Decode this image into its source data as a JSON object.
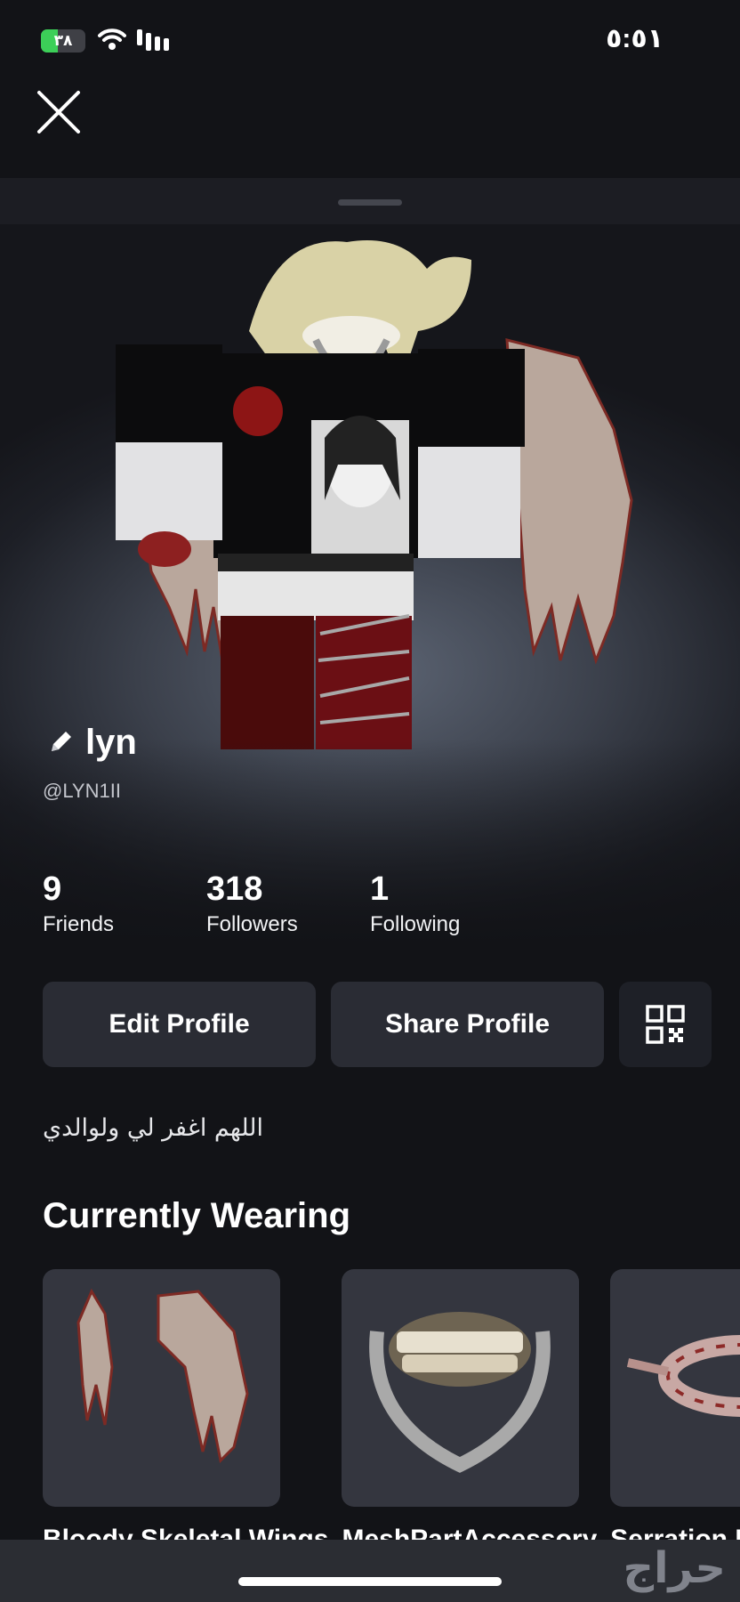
{
  "status_bar": {
    "battery_text": "٣٨",
    "battery_level": 0.38,
    "time": "٥:٥١"
  },
  "profile": {
    "display_name": "lyn",
    "username": "@LYN1II",
    "stats": [
      {
        "value": "9",
        "label": "Friends"
      },
      {
        "value": "318",
        "label": "Followers"
      },
      {
        "value": "1",
        "label": "Following"
      }
    ],
    "edit_label": "Edit Profile",
    "share_label": "Share Profile",
    "bio": "اللهم اغفر لي ولوالدي"
  },
  "wearing": {
    "title": "Currently Wearing",
    "items": [
      {
        "name": "Bloody Skeletal Wings",
        "icon": "bloody-wings-thumbnail"
      },
      {
        "name": "MeshPartAccessory",
        "icon": "teeth-mouthguard-thumbnail"
      },
      {
        "name": "Serration Headband",
        "icon": "bloody-bandage-thumbnail"
      }
    ]
  },
  "watermark": "حراج",
  "colors": {
    "background": "#121317",
    "button": "#2a2c34",
    "battery_green": "#3ccf58"
  }
}
